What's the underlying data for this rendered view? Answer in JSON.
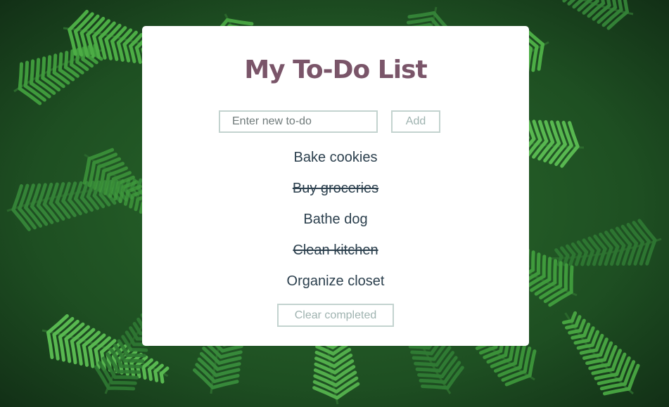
{
  "app": {
    "title": "My To-Do List"
  },
  "form": {
    "input_value": "",
    "input_placeholder": "Enter new to-do",
    "add_label": "Add"
  },
  "todos": [
    {
      "text": "Bake cookies",
      "completed": false
    },
    {
      "text": "Buy groceries",
      "completed": true
    },
    {
      "text": "Bathe dog",
      "completed": false
    },
    {
      "text": "Clean kitchen",
      "completed": true
    },
    {
      "text": "Organize closet",
      "completed": false
    }
  ],
  "clear_label": "Clear completed",
  "colors": {
    "title": "#7a5569",
    "text": "#2b3f4d",
    "muted": "#9fb3b0",
    "border": "#c3d3cf",
    "card": "#ffffff",
    "background": "#1f4a22"
  }
}
